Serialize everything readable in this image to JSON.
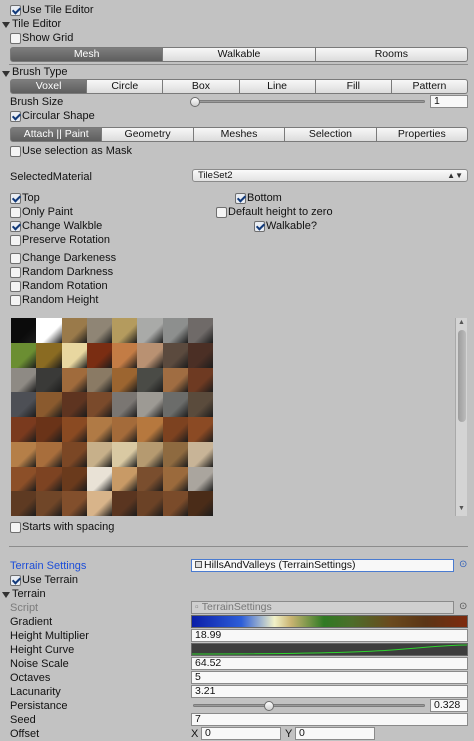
{
  "top": {
    "use_tile_editor": "Use Tile Editor",
    "tile_editor_section": "Tile Editor",
    "show_grid": "Show Grid"
  },
  "mode_toolbar": [
    "Mesh",
    "Walkable",
    "Rooms"
  ],
  "brush_type": {
    "label": "Brush Type",
    "options": [
      "Voxel",
      "Circle",
      "Box",
      "Line",
      "Fill",
      "Pattern"
    ],
    "brush_size_label": "Brush Size",
    "brush_size_value": "1",
    "brush_size_fraction": 0.0,
    "circular_shape": "Circular Shape"
  },
  "paint_tabs": [
    "Attach || Paint",
    "Geometry",
    "Meshes",
    "Selection",
    "Properties"
  ],
  "use_selection_mask": "Use selection as Mask",
  "material": {
    "label": "SelectedMaterial",
    "value": "TileSet2"
  },
  "options": {
    "top": "Top",
    "bottom": "Bottom",
    "only_paint": "Only Paint",
    "default_height": "Default height to zero",
    "change_walkable": "Change Walkble",
    "walkable": "Walkable?",
    "preserve_rotation": "Preserve Rotation",
    "change_darkeness": "Change Darkeness",
    "random_darkness": "Random Darkness",
    "random_rotation": "Random Rotation",
    "random_height": "Random Height"
  },
  "tileset": {
    "colors": [
      "#0b0b0b",
      "#ffffff",
      "#9a7a4a",
      "#8f8575",
      "#b49b5e",
      "#a9aaa8",
      "#8d8f8e",
      "#6f6a68",
      "#6b8e32",
      "#8a6b22",
      "#e8d7a0",
      "#7a2d12",
      "#c37c45",
      "#b99172",
      "#5b4a3e",
      "#4b2f25",
      "#8e8a84",
      "#3a3a38",
      "#a06b3c",
      "#8a7a64",
      "#9c6530",
      "#4a4b46",
      "#a06d42",
      "#6e3a22",
      "#4d4f55",
      "#8a5a2e",
      "#5e3420",
      "#7a4a2b",
      "#7a7672",
      "#9d9a94",
      "#6b6c6a",
      "#5a4b3c",
      "#7a3a1e",
      "#6a3318",
      "#8a4a22",
      "#b07a45",
      "#a46b3a",
      "#b6783e",
      "#7d4220",
      "#8b4a24",
      "#b57f48",
      "#a86e3c",
      "#7b4725",
      "#c7b08a",
      "#d9c9a3",
      "#b59a70",
      "#8e6a40",
      "#c8b497",
      "#8c4f28",
      "#7d4322",
      "#6a3a1c",
      "#e9e2d6",
      "#c89a66",
      "#7a4e2e",
      "#9b6a3c",
      "#aaa59e",
      "#5e3a22",
      "#704628",
      "#824f2c",
      "#d8b48a",
      "#5a3520",
      "#6b4226",
      "#7a4b2a",
      "#4a2c18"
    ]
  },
  "starts_with_spacing": "Starts with spacing",
  "terrain_settings": {
    "label": "Terrain Settings",
    "value": "HillsAndValleys (TerrainSettings)",
    "use_terrain": "Use Terrain",
    "terrain_section": "Terrain",
    "script_label": "Script",
    "script_value": "TerrainSettings",
    "gradient_label": "Gradient",
    "height_multiplier_label": "Height Multiplier",
    "height_multiplier_value": "18.99",
    "height_curve_label": "Height Curve",
    "noise_scale_label": "Noise Scale",
    "noise_scale_value": "64.52",
    "octaves_label": "Octaves",
    "octaves_value": "5",
    "lacunarity_label": "Lacunarity",
    "lacunarity_value": "3.21",
    "persistance_label": "Persistance",
    "persistance_value": "0.328",
    "persistance_fraction": 0.328,
    "seed_label": "Seed",
    "seed_value": "7",
    "offset_label": "Offset",
    "offset_x_label": "X",
    "offset_x_value": "0",
    "offset_y_label": "Y",
    "offset_y_value": "0"
  },
  "colors": {
    "selected_segment": "#6a6a6a",
    "link_label": "#1d4ed8",
    "panel_background": "#c2c2c2"
  }
}
